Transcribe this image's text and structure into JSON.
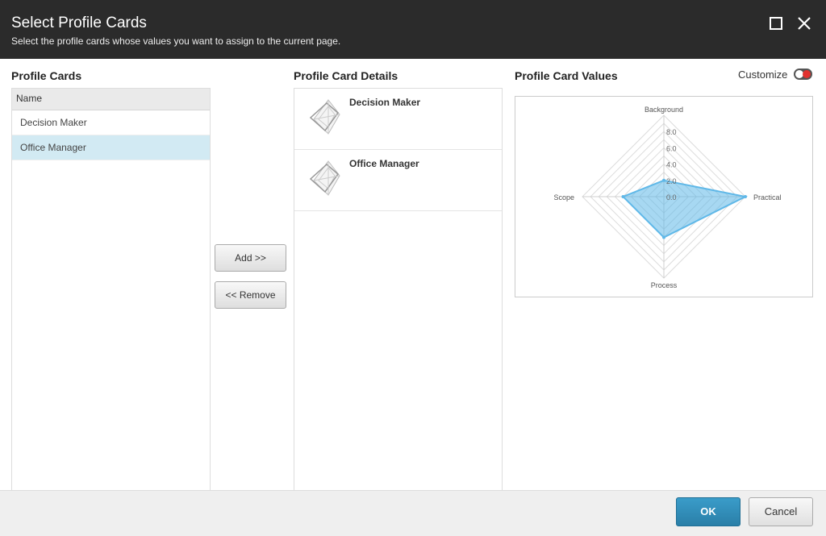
{
  "dialog": {
    "title": "Select Profile Cards",
    "subtitle": "Select the profile cards whose values you want to assign to the current page."
  },
  "profile_cards": {
    "title": "Profile Cards",
    "column_header": "Name",
    "rows": [
      {
        "label": "Decision Maker",
        "selected": false
      },
      {
        "label": "Office Manager",
        "selected": true
      }
    ]
  },
  "actions": {
    "add_label": "Add >>",
    "remove_label": "<< Remove"
  },
  "details": {
    "title": "Profile Card Details",
    "items": [
      {
        "name": "Decision Maker"
      },
      {
        "name": "Office Manager"
      }
    ]
  },
  "values": {
    "title": "Profile Card Values",
    "customize_label": "Customize",
    "customize_on": false
  },
  "chart_data": {
    "type": "radar",
    "axes": [
      "Background",
      "Practical",
      "Process",
      "Scope"
    ],
    "tick_labels": [
      "0.0",
      "2.0",
      "4.0",
      "6.0",
      "8.0"
    ],
    "range": [
      0,
      10
    ],
    "series": [
      {
        "values": [
          2,
          10,
          5,
          5
        ],
        "color": "#5fb8e8"
      }
    ],
    "grid": true
  },
  "footer": {
    "ok_label": "OK",
    "cancel_label": "Cancel"
  },
  "colors": {
    "header_bg": "#2b2b2b",
    "selected_row": "#d2eaf3",
    "primary_button": "#2a8ab8",
    "series_fill": "#5fb8e8"
  }
}
